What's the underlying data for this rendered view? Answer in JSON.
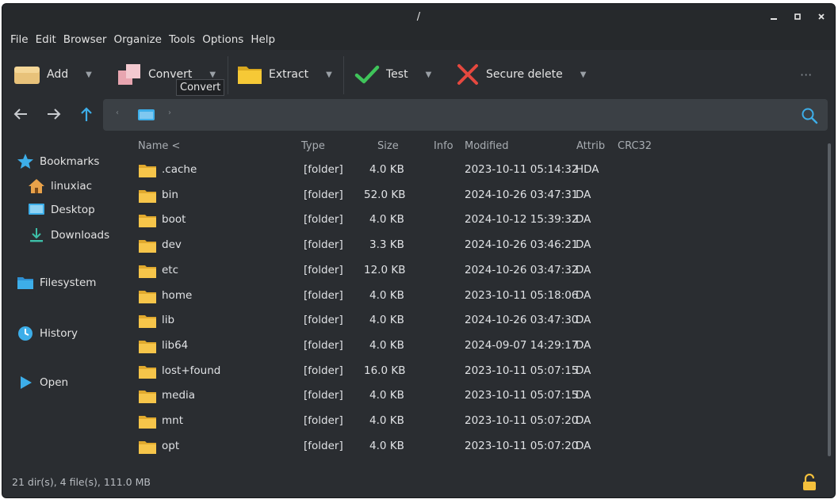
{
  "window": {
    "title": "/"
  },
  "menu": [
    "File",
    "Edit",
    "Browser",
    "Organize",
    "Tools",
    "Options",
    "Help"
  ],
  "toolbar": {
    "add": "Add",
    "convert": "Convert",
    "extract": "Extract",
    "test": "Test",
    "secure_delete": "Secure delete",
    "more": "···",
    "tooltip": "Convert"
  },
  "sidebar": {
    "bookmarks": "Bookmarks",
    "linuxiac": "linuxiac",
    "desktop": "Desktop",
    "downloads": "Downloads",
    "filesystem": "Filesystem",
    "history": "History",
    "open": "Open"
  },
  "columns": {
    "name": "Name <",
    "type": "Type",
    "size": "Size",
    "info": "Info",
    "modified": "Modified",
    "attrib": "Attrib",
    "crc": "CRC32"
  },
  "files": [
    {
      "name": ".cache",
      "type": "[folder]",
      "size": "4.0 KB",
      "modified": "2023-10-11 05:14:32",
      "attrib": "HDA"
    },
    {
      "name": "bin",
      "type": "[folder]",
      "size": "52.0 KB",
      "modified": "2024-10-26 03:47:31",
      "attrib": "DA"
    },
    {
      "name": "boot",
      "type": "[folder]",
      "size": "4.0 KB",
      "modified": "2024-10-12 15:39:32",
      "attrib": "DA"
    },
    {
      "name": "dev",
      "type": "[folder]",
      "size": "3.3 KB",
      "modified": "2024-10-26 03:46:21",
      "attrib": "DA"
    },
    {
      "name": "etc",
      "type": "[folder]",
      "size": "12.0 KB",
      "modified": "2024-10-26 03:47:32",
      "attrib": "DA"
    },
    {
      "name": "home",
      "type": "[folder]",
      "size": "4.0 KB",
      "modified": "2023-10-11 05:18:06",
      "attrib": "DA"
    },
    {
      "name": "lib",
      "type": "[folder]",
      "size": "4.0 KB",
      "modified": "2024-10-26 03:47:30",
      "attrib": "DA"
    },
    {
      "name": "lib64",
      "type": "[folder]",
      "size": "4.0 KB",
      "modified": "2024-09-07 14:29:17",
      "attrib": "DA"
    },
    {
      "name": "lost+found",
      "type": "[folder]",
      "size": "16.0 KB",
      "modified": "2023-10-11 05:07:15",
      "attrib": "DA"
    },
    {
      "name": "media",
      "type": "[folder]",
      "size": "4.0 KB",
      "modified": "2023-10-11 05:07:15",
      "attrib": "DA"
    },
    {
      "name": "mnt",
      "type": "[folder]",
      "size": "4.0 KB",
      "modified": "2023-10-11 05:07:20",
      "attrib": "DA"
    },
    {
      "name": "opt",
      "type": "[folder]",
      "size": "4.0 KB",
      "modified": "2023-10-11 05:07:20",
      "attrib": "DA"
    }
  ],
  "status": {
    "text": "21 dir(s), 4 file(s), 111.0 MB"
  },
  "colors": {
    "accent": "#3daee9",
    "folder": "#f6c54a",
    "background": "#2a2d31"
  }
}
